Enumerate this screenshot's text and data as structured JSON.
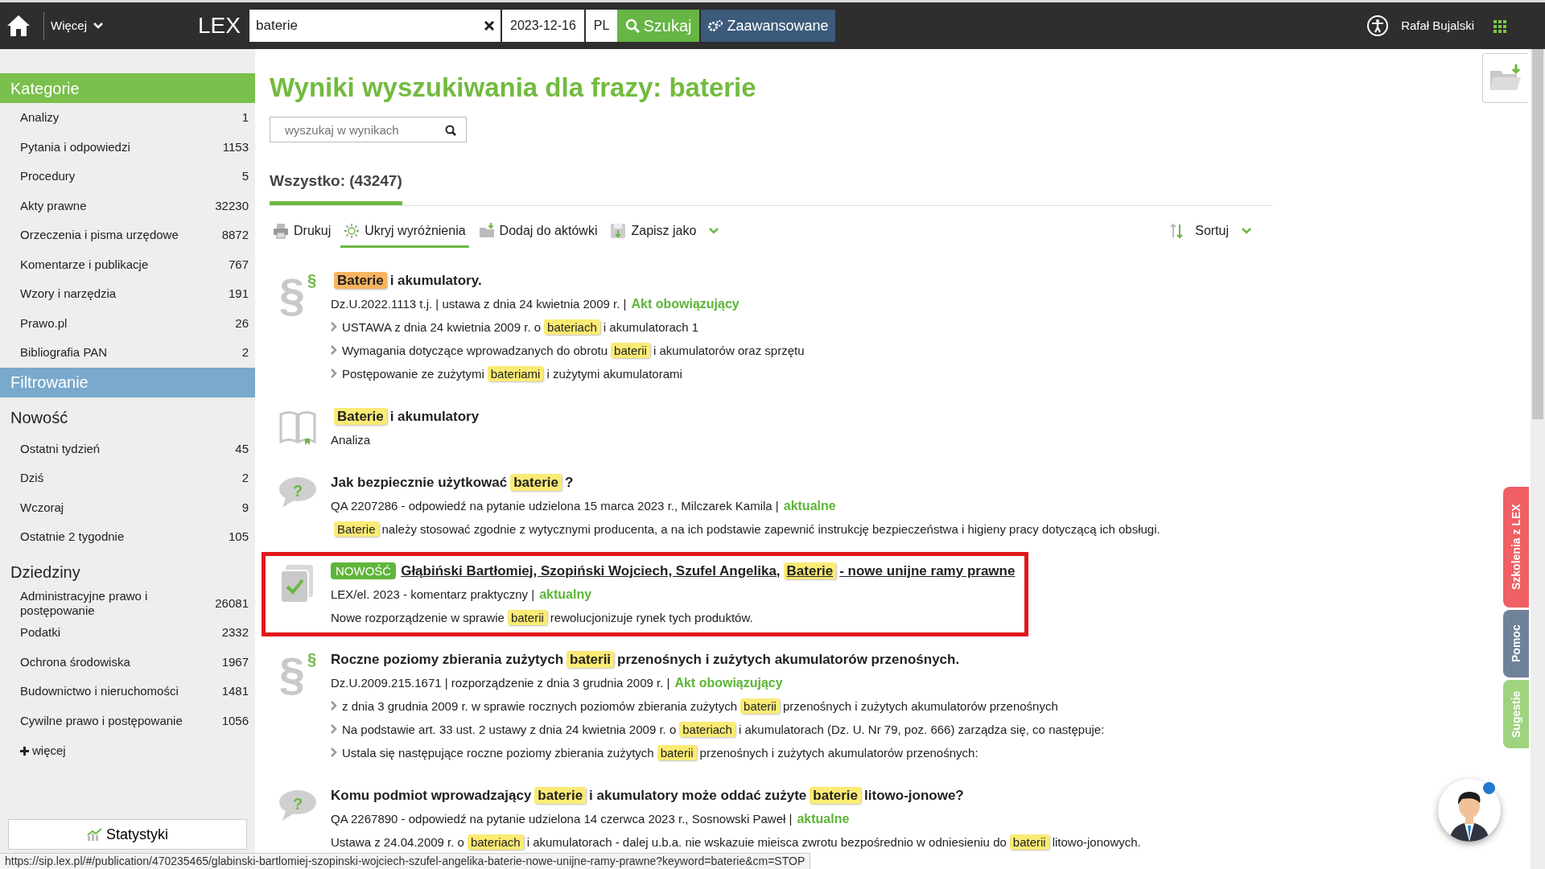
{
  "topbar": {
    "more_menu": "Więcej",
    "logo": "LEX",
    "search": {
      "value": "baterie"
    },
    "date": "2023-12-16",
    "language": "PL",
    "search_button": "Szukaj",
    "advanced_button": "Zaawansowane",
    "user": "Rafał Bujalski"
  },
  "sidebar": {
    "categories_title": "Kategorie",
    "categories": [
      {
        "label": "Analizy",
        "count": "1"
      },
      {
        "label": "Pytania i odpowiedzi",
        "count": "1153"
      },
      {
        "label": "Procedury",
        "count": "5"
      },
      {
        "label": "Akty prawne",
        "count": "32230"
      },
      {
        "label": "Orzeczenia i pisma urzędowe",
        "count": "8872"
      },
      {
        "label": "Komentarze i publikacje",
        "count": "767"
      },
      {
        "label": "Wzory i narzędzia",
        "count": "191"
      },
      {
        "label": "Prawo.pl",
        "count": "26"
      },
      {
        "label": "Bibliografia PAN",
        "count": "2"
      }
    ],
    "filter_title": "Filtrowanie",
    "filter_groups": [
      {
        "title": "Nowość",
        "items": [
          {
            "label": "Ostatni tydzień",
            "count": "45"
          },
          {
            "label": "Dziś",
            "count": "2"
          },
          {
            "label": "Wczoraj",
            "count": "9"
          },
          {
            "label": "Ostatnie 2 tygodnie",
            "count": "105"
          }
        ]
      },
      {
        "title": "Dziedziny",
        "items": [
          {
            "label": "Administracyjne prawo i postępowanie",
            "count": "26081"
          },
          {
            "label": "Podatki",
            "count": "2332"
          },
          {
            "label": "Ochrona środowiska",
            "count": "1967"
          },
          {
            "label": "Budownictwo i nieruchomości",
            "count": "1481"
          },
          {
            "label": "Cywilne prawo i postępowanie",
            "count": "1056"
          }
        ]
      }
    ],
    "more_link": "więcej",
    "stats_button": "Statystyki"
  },
  "main": {
    "title": "Wyniki wyszukiwania dla frazy: baterie",
    "filter_search": {
      "placeholder": "wyszukaj w wynikach"
    },
    "tabs": [
      {
        "label": "Wszystko: (43247)",
        "selected": true
      }
    ],
    "toolbar": [
      {
        "kind": "print",
        "label": "Drukuj",
        "selected": false
      },
      {
        "kind": "highlight",
        "label": "Ukryj wyróżnienia",
        "selected": true
      },
      {
        "kind": "folder",
        "label": "Dodaj do aktówki",
        "selected": false
      },
      {
        "kind": "save",
        "label": "Zapisz jako",
        "selected": false,
        "dropdown": true
      }
    ],
    "sort": "Sortuj",
    "results": [
      {
        "kind": "act",
        "glyph": "§",
        "glyph_small": "§",
        "framed": false,
        "title": [
          {
            "kind": "current",
            "text": "Baterie"
          },
          {
            "kind": "text",
            "text": "i akumulatory."
          }
        ],
        "meta": "Dz.U.2022.1113 t.j. | ustawa z dnia 24 kwietnia 2009 r. |",
        "status": "Akt obowiązujący",
        "fragments": [
          {
            "bullet": true,
            "parts": [
              {
                "kind": "text",
                "text": "USTAWA z dnia 24 kwietnia 2009 r. o"
              },
              {
                "kind": "match",
                "text": "bateriach"
              },
              {
                "kind": "text",
                "text": "i akumulatorach 1"
              }
            ]
          },
          {
            "bullet": true,
            "parts": [
              {
                "kind": "text",
                "text": "Wymagania dotyczące wprowadzanych do obrotu"
              },
              {
                "kind": "match",
                "text": "baterii"
              },
              {
                "kind": "text",
                "text": "i akumulatorów oraz sprzętu"
              }
            ]
          },
          {
            "bullet": true,
            "parts": [
              {
                "kind": "text",
                "text": "Postępowanie ze zużytymi"
              },
              {
                "kind": "match",
                "text": "bateriami"
              },
              {
                "kind": "text",
                "text": "i zużytymi akumulatorami"
              }
            ]
          }
        ]
      },
      {
        "kind": "analysis",
        "framed": false,
        "title": [
          {
            "kind": "match",
            "text": "Baterie"
          },
          {
            "kind": "text",
            "text": "i akumulatory"
          }
        ],
        "meta": "Analiza"
      },
      {
        "kind": "question",
        "glyph": "?",
        "framed": false,
        "title": [
          {
            "kind": "text",
            "text": "Jak bezpiecznie użytkować"
          },
          {
            "kind": "match",
            "text": "baterie"
          },
          {
            "kind": "text",
            "text": "?"
          }
        ],
        "meta": "QA 2207286 - odpowiedź na pytanie udzielona 15 marca 2023 r., Milczarek Kamila |",
        "status": "aktualne",
        "fragments": [
          {
            "bullet": false,
            "parts": [
              {
                "kind": "match",
                "text": "Baterie"
              },
              {
                "kind": "text",
                "text": "należy stosować zgodnie z wytycznymi producenta, a na ich podstawie zapewnić instrukcję bezpieczeństwa i higieny pracy dotyczącą ich obsługi."
              }
            ]
          }
        ]
      },
      {
        "kind": "commentary",
        "badge": "NOWOŚĆ",
        "framed": true,
        "title": [
          {
            "kind": "text",
            "text": "Głąbiński Bartłomiej, Szopiński Wojciech, Szufel Angelika,"
          },
          {
            "kind": "match",
            "text": "Baterie"
          },
          {
            "kind": "text",
            "text": "- nowe unijne ramy prawne"
          }
        ],
        "meta": "LEX/el. 2023 - komentarz praktyczny |",
        "status": "aktualny",
        "fragments": [
          {
            "bullet": false,
            "parts": [
              {
                "kind": "text",
                "text": "Nowe rozporządzenie w sprawie"
              },
              {
                "kind": "match",
                "text": "baterii"
              },
              {
                "kind": "text",
                "text": "rewolucjonizuje rynek tych produktów."
              }
            ]
          }
        ]
      },
      {
        "kind": "act",
        "glyph": "§",
        "glyph_small": "§",
        "framed": false,
        "title": [
          {
            "kind": "text",
            "text": "Roczne poziomy zbierania zużytych"
          },
          {
            "kind": "match",
            "text": "baterii"
          },
          {
            "kind": "text",
            "text": "przenośnych i zużytych akumulatorów przenośnych."
          }
        ],
        "meta": "Dz.U.2009.215.1671 | rozporządzenie z dnia 3 grudnia 2009 r. |",
        "status": "Akt obowiązujący",
        "fragments": [
          {
            "bullet": true,
            "parts": [
              {
                "kind": "text",
                "text": "z dnia 3 grudnia 2009 r. w sprawie rocznych poziomów zbierania zużytych"
              },
              {
                "kind": "match",
                "text": "baterii"
              },
              {
                "kind": "text",
                "text": "przenośnych i zużytych akumulatorów przenośnych"
              }
            ]
          },
          {
            "bullet": true,
            "parts": [
              {
                "kind": "text",
                "text": "Na podstawie art. 33 ust. 2 ustawy z dnia 24 kwietnia 2009 r. o"
              },
              {
                "kind": "match",
                "text": "bateriach"
              },
              {
                "kind": "text",
                "text": "i akumulatorach (Dz. U. Nr 79, poz. 666) zarządza się, co następuje:"
              }
            ]
          },
          {
            "bullet": true,
            "parts": [
              {
                "kind": "text",
                "text": "Ustala się następujące roczne poziomy zbierania zużytych"
              },
              {
                "kind": "match",
                "text": "baterii"
              },
              {
                "kind": "text",
                "text": "przenośnych i zużytych akumulatorów przenośnych:"
              }
            ]
          }
        ]
      },
      {
        "kind": "question",
        "glyph": "?",
        "framed": false,
        "title": [
          {
            "kind": "text",
            "text": "Komu podmiot wprowadzający"
          },
          {
            "kind": "match",
            "text": "baterie"
          },
          {
            "kind": "text",
            "text": "i akumulatory może oddać zużyte"
          },
          {
            "kind": "match",
            "text": "baterie"
          },
          {
            "kind": "text",
            "text": "litowo-jonowe?"
          }
        ],
        "meta": "QA 2267890 - odpowiedź na pytanie udzielona 14 czerwca 2023 r., Sosnowski Paweł |",
        "status": "aktualne",
        "fragments": [
          {
            "bullet": false,
            "parts": [
              {
                "kind": "text",
                "text": "Ustawa z 24.04.2009 r. o"
              },
              {
                "kind": "match",
                "text": "bateriach"
              },
              {
                "kind": "text",
                "text": "i akumulatorach - dalej u.b.a. nie wskazuie mieisca zwrotu bezpośrednio w odniesieniu do"
              },
              {
                "kind": "match",
                "text": "baterii"
              },
              {
                "kind": "text",
                "text": "litowo-jonowych."
              }
            ]
          }
        ]
      }
    ]
  },
  "side_tabs": [
    {
      "label": "Szkolenia z LEX",
      "color": "#ef5f63"
    },
    {
      "label": "Pomoc",
      "color": "#6f8299"
    },
    {
      "label": "Sugestie",
      "color": "#9fd37f"
    }
  ],
  "status_bar": "https://sip.lex.pl/#/publication/470235465/glabinski-bartlomiej-szopinski-wojciech-szufel-angelika-baterie-nowe-unijne-ramy-prawne?keyword=baterie&cm=STOP"
}
